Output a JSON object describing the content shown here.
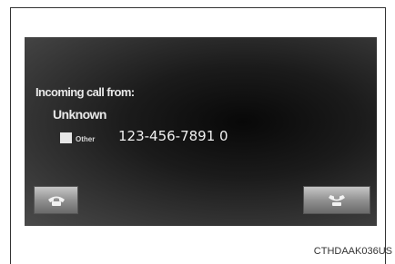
{
  "call_screen": {
    "title": "Incoming call from:",
    "caller_name": "Unknown",
    "number_type": "Other",
    "phone_number": "123-456-7891 0"
  },
  "buttons": {
    "accept_icon": "phone-handset-icon",
    "decline_icon": "phone-hang-up-icon"
  },
  "figure_code": "CTHDAAK036US"
}
